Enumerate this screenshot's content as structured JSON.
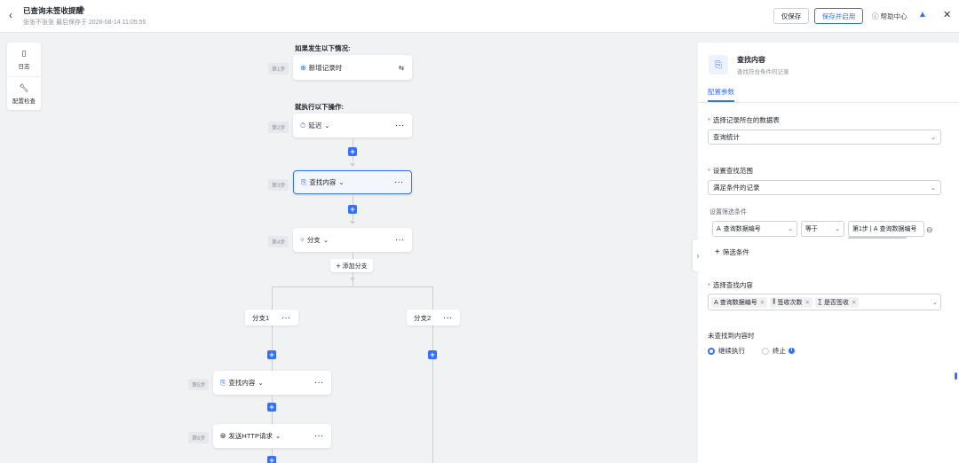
{
  "header": {
    "back_icon": "chevron-left-icon",
    "title": "已查询未签收提醒",
    "edit_icon": "pencil-icon",
    "subtitle": "张张不张张 最后保存于 2026-08-14 11:05:55",
    "save_label": "仅保存",
    "save_enable_label": "保存并启用",
    "help_label": "帮助中心",
    "help_icon": "question-circle-icon",
    "logo_icon": "app-logo-icon",
    "close_icon": "close-icon"
  },
  "tools": [
    {
      "label": "日志",
      "icon": "log-icon"
    },
    {
      "label": "配置检查",
      "icon": "wrench-icon"
    }
  ],
  "canvas": {
    "trigger_title": "如果发生以下情况:",
    "action_title": "就执行以下操作:",
    "trigger": {
      "step": "第1步",
      "label": "新增记录时",
      "icon": "plus-circle-icon",
      "swap_icon": "swap-icon"
    },
    "steps": [
      {
        "step": "第2步",
        "label": "延迟",
        "icon": "timer-icon"
      },
      {
        "step": "第3步",
        "label": "查找内容",
        "icon": "search-record-icon"
      },
      {
        "step": "第4步",
        "label": "分支",
        "icon": "branch-icon"
      }
    ],
    "add_branch_label": "添加分支",
    "branches": [
      {
        "label": "分支1"
      },
      {
        "label": "分支2"
      }
    ],
    "branch1_steps": [
      {
        "step": "第5步",
        "label": "查找内容",
        "icon": "search-record-icon"
      },
      {
        "step": "第6步",
        "label": "发送HTTP请求",
        "icon": "globe-icon"
      }
    ],
    "more_label": "···",
    "plus_label": "+"
  },
  "panel": {
    "icon": "search-record-icon",
    "title": "查找内容",
    "desc": "查找符合条件的记录",
    "tab": "配置参数",
    "table_label": "选择记录所在的数据表",
    "table_value": "查询统计",
    "range_label": "设置查找范围",
    "range_value": "满足条件的记录",
    "filter_label": "设置筛选条件",
    "filter": {
      "field": "查询数据编号",
      "operator": "等于",
      "value_step": "第1步",
      "value_field": "查询数据编号",
      "remove_icon": "minus-circle-icon"
    },
    "add_filter_label": "筛选条件",
    "content_label": "选择查找内容",
    "content_tags": [
      {
        "label": "查询数据编号",
        "icon": "text-icon"
      },
      {
        "label": "签收次数",
        "icon": "chart-icon"
      },
      {
        "label": "是否签收",
        "icon": "sum-icon"
      }
    ],
    "notfound_label": "未查找到内容时",
    "options": [
      {
        "label": "继续执行",
        "selected": true
      },
      {
        "label": "终止",
        "selected": false
      }
    ],
    "required_mark": "*",
    "collapse_icon": "chevron-right-icon",
    "accent_color": "#3370ff"
  }
}
